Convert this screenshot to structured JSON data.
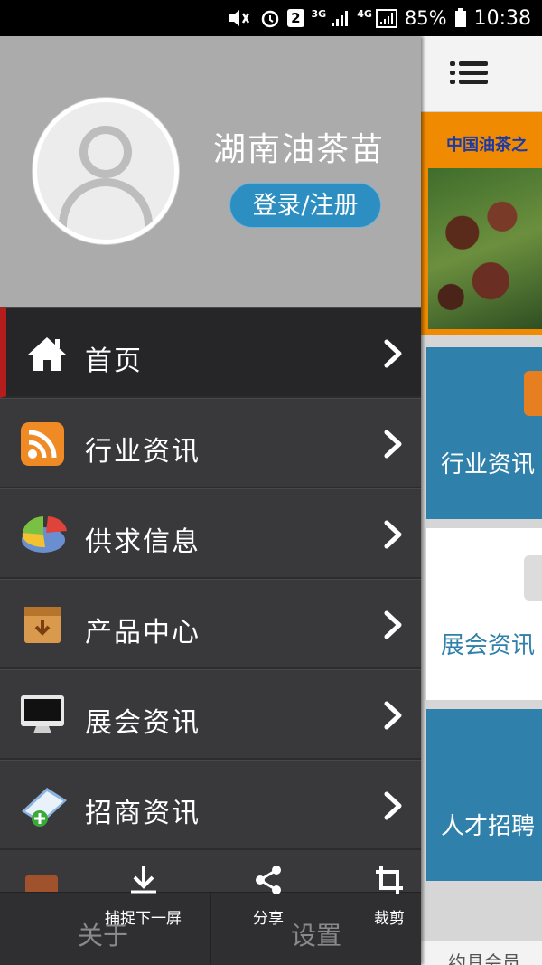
{
  "status_bar": {
    "network": "3G",
    "network2": "4G",
    "sim_badge": "2",
    "battery": "85%",
    "time": "10:38"
  },
  "drawer": {
    "brand": "湖南油茶苗",
    "login_label": "登录/注册",
    "menu": [
      {
        "label": "首页",
        "icon": "home-icon",
        "active": true
      },
      {
        "label": "行业资讯",
        "icon": "rss-icon"
      },
      {
        "label": "供求信息",
        "icon": "pie-chart-icon"
      },
      {
        "label": "产品中心",
        "icon": "box-icon"
      },
      {
        "label": "展会资讯",
        "icon": "monitor-icon"
      },
      {
        "label": "招商资讯",
        "icon": "notebook-add-icon"
      }
    ],
    "bottom": {
      "about": "关于",
      "settings": "设置"
    }
  },
  "overlay_actions": {
    "capture_next": "捕捉下一屏",
    "share": "分享",
    "crop": "裁剪"
  },
  "main": {
    "banner_title": "中国油茶之",
    "tiles": [
      "行业资讯",
      "展会资讯",
      "人才招聘"
    ],
    "bottom_text": "约具会员"
  },
  "colors": {
    "accent_blue": "#2f80ab",
    "active_marker": "#b51d1d",
    "drawer_bg": "#3a3a3c",
    "banner_orange": "#f08a00"
  }
}
